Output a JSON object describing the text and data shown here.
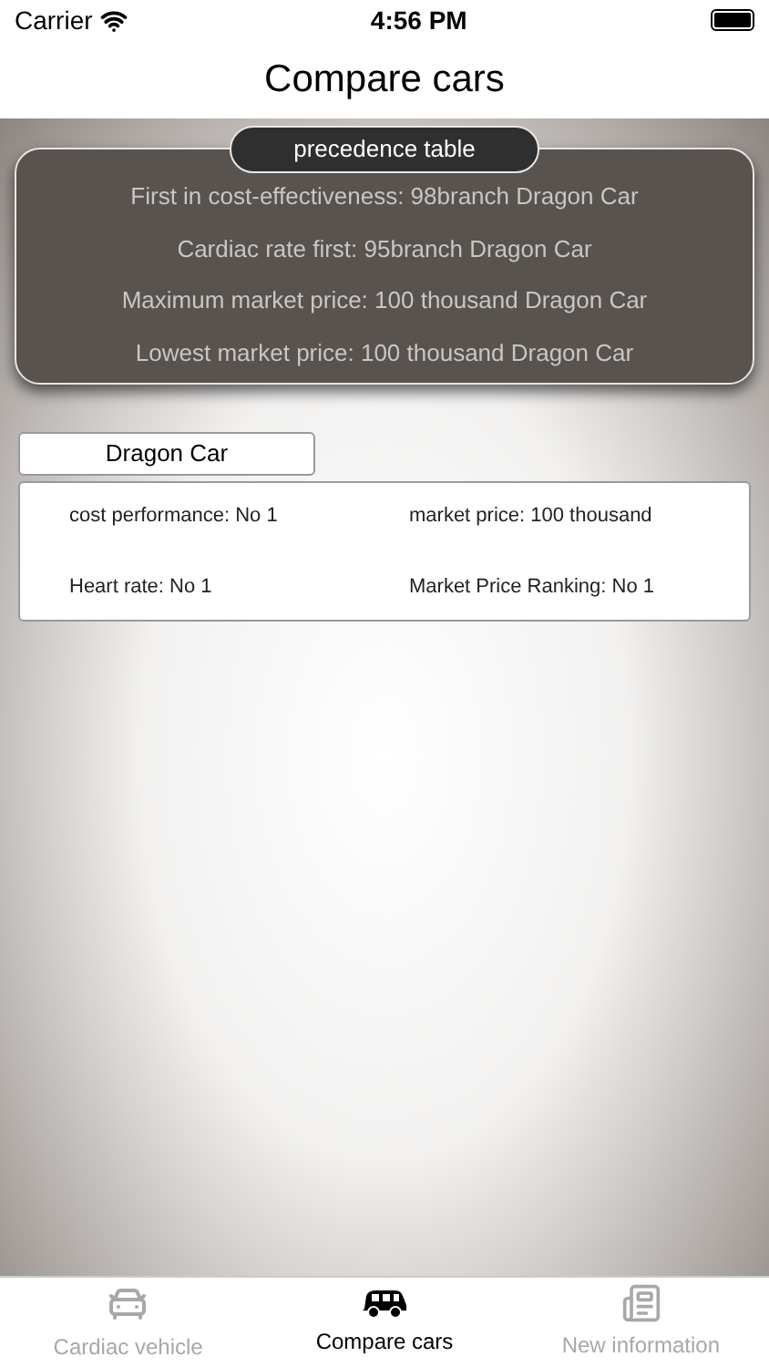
{
  "status_bar": {
    "carrier": "Carrier",
    "time": "4:56 PM"
  },
  "nav": {
    "title": "Compare cars"
  },
  "precedence": {
    "title": "precedence table",
    "lines": [
      "First in cost-effectiveness: 98branch Dragon Car",
      "Cardiac rate first: 95branch Dragon Car",
      "Maximum market price: 100 thousand Dragon Car",
      "Lowest market price: 100 thousand Dragon Car"
    ]
  },
  "car": {
    "name": "Dragon Car",
    "stats": [
      "cost performance: No 1",
      "market price: 100 thousand",
      "Heart rate: No 1",
      "Market Price Ranking: No 1"
    ]
  },
  "tabs": [
    {
      "label": "Cardiac vehicle",
      "kind": "car",
      "selected": false
    },
    {
      "label": "Compare cars",
      "kind": "van",
      "selected": true
    },
    {
      "label": "New information",
      "kind": "news",
      "selected": false
    }
  ]
}
